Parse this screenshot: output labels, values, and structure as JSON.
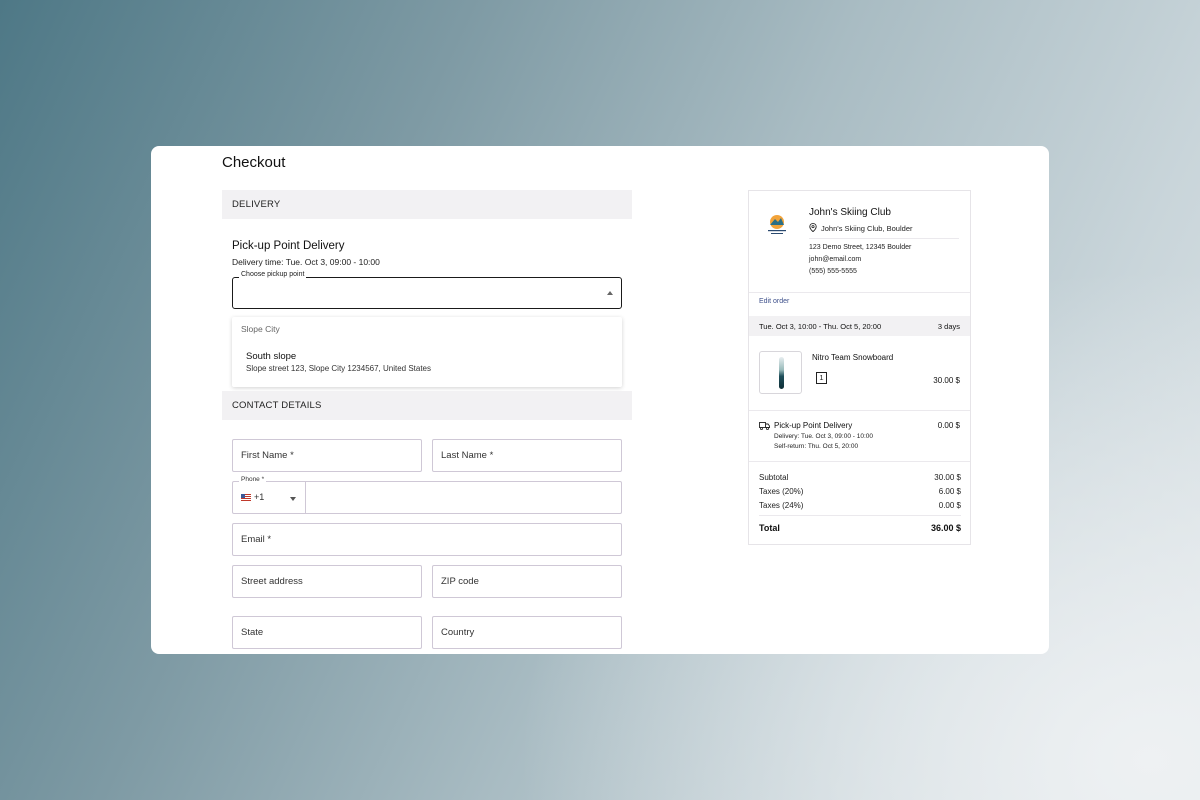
{
  "checkout": {
    "title": "Checkout",
    "delivery_section": "DELIVERY",
    "delivery_method": "Pick-up Point Delivery",
    "delivery_time": "Delivery time: Tue. Oct 3, 09:00 - 10:00",
    "pickup_select": {
      "label": "Choose pickup point",
      "value": "",
      "options_group": "Slope City",
      "options": [
        {
          "title": "South slope",
          "address": "Slope street 123, Slope City 1234567, United States"
        }
      ]
    },
    "contact_section": "CONTACT DETAILS",
    "fields": {
      "first_name": "First Name *",
      "last_name": "Last Name *",
      "phone_label": "Phone *",
      "phone_code": "+1",
      "email": "Email *",
      "street": "Street address",
      "zip": "ZIP code",
      "state": "State",
      "country": "Country"
    }
  },
  "summary": {
    "shop_name": "John's Skiing Club",
    "shop_location": "John's Skiing Club, Boulder",
    "address": "123 Demo Street, 12345 Boulder",
    "email": "john@email.com",
    "phone": "(555) 555-5555",
    "edit_order": "Edit order",
    "period": "Tue. Oct 3, 10:00 - Thu. Oct 5, 20:00",
    "duration": "3 days",
    "product": {
      "name": "Nitro Team Snowboard",
      "qty": "1",
      "price": "30.00 $"
    },
    "shipping": {
      "title": "Pick-up Point Delivery",
      "price": "0.00 $",
      "delivery": "Delivery: Tue. Oct 3, 09:00 - 10:00",
      "self_return": "Self-return: Thu. Oct 5, 20:00"
    },
    "totals": {
      "subtotal_label": "Subtotal",
      "subtotal": "30.00 $",
      "tax1_label": "Taxes (20%)",
      "tax1": "6.00 $",
      "tax2_label": "Taxes (24%)",
      "tax2": "0.00 $",
      "total_label": "Total",
      "total": "36.00 $"
    }
  },
  "colors": {
    "accent_link": "#3d4f8a",
    "section_bg": "#f2f1f3",
    "field_border": "#cfc8d6"
  },
  "icons": [
    "location-pin-icon",
    "truck-icon",
    "chevron-down-icon",
    "us-flag-icon",
    "shop-logo"
  ]
}
